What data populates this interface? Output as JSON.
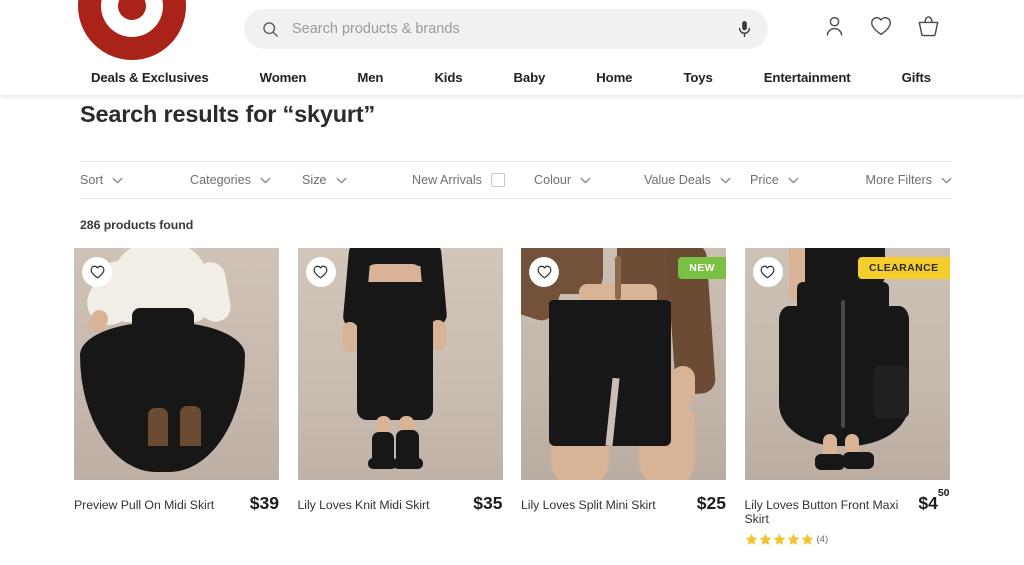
{
  "header": {
    "logo_name": "target-bullseye-logo",
    "search": {
      "placeholder": "Search products & brands",
      "value": "",
      "search_icon": "search-icon",
      "mic_icon": "microphone-icon"
    },
    "actions": [
      {
        "name": "account-icon",
        "label": "Account"
      },
      {
        "name": "wishlist-icon",
        "label": "Wishlist"
      },
      {
        "name": "basket-icon",
        "label": "Basket"
      }
    ],
    "nav": [
      "Deals & Exclusives",
      "Women",
      "Men",
      "Kids",
      "Baby",
      "Home",
      "Toys",
      "Entertainment",
      "Gifts"
    ]
  },
  "main": {
    "title": "Search results for “skyurt”",
    "results_count": "286 products found",
    "filters": [
      {
        "label": "Sort",
        "type": "dropdown"
      },
      {
        "label": "Categories",
        "type": "dropdown"
      },
      {
        "label": "Size",
        "type": "dropdown"
      },
      {
        "label": "New Arrivals",
        "type": "checkbox",
        "checked": false
      },
      {
        "label": "Colour",
        "type": "dropdown"
      },
      {
        "label": "Value Deals",
        "type": "dropdown"
      },
      {
        "label": "Price",
        "type": "dropdown"
      },
      {
        "label": "More Filters",
        "type": "dropdown"
      }
    ],
    "products": [
      {
        "name": "Preview Pull On Midi Skirt",
        "price": "$39",
        "price_cents": "",
        "badge": null,
        "rating": null,
        "reviews": null
      },
      {
        "name": "Lily Loves Knit Midi Skirt",
        "price": "$35",
        "price_cents": "",
        "badge": null,
        "rating": null,
        "reviews": null
      },
      {
        "name": "Lily Loves Split Mini Skirt",
        "price": "$25",
        "price_cents": "",
        "badge": "NEW",
        "badge_type": "new",
        "rating": null,
        "reviews": null
      },
      {
        "name": "Lily Loves Button Front Maxi Skirt",
        "price": "$4",
        "price_cents": "50",
        "badge": "CLEARANCE",
        "badge_type": "clearance",
        "rating": 5,
        "reviews": "(4)"
      }
    ]
  },
  "colors": {
    "brand_red": "#AA2318",
    "badge_new": "#7AC143",
    "badge_clearance": "#F5CE2E",
    "star_gold": "#F2C431",
    "search_bg": "#f1f1f1"
  }
}
